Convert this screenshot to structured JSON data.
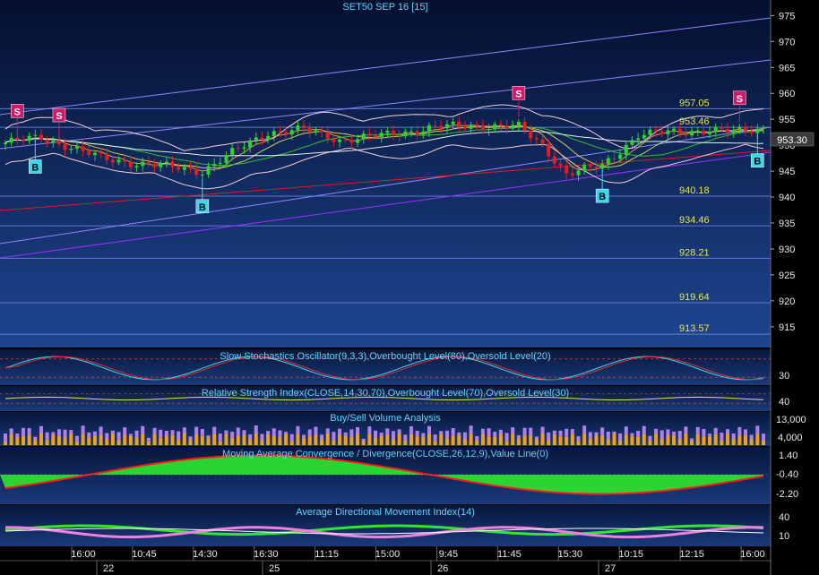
{
  "colors": {
    "panel_top": "#0a1a3c",
    "panel_bottom": "#1b3c80",
    "axis_text": "#e8e8e8",
    "title_text": "#5fd4ff",
    "level_text": "#e6e64a",
    "price_tag": "#3a3a3a",
    "up": "#2fd32f",
    "down": "#e01f1f",
    "buy_marker": "#39d8f0",
    "sell_marker": "#d4186a",
    "stoch_k": "#3fd8f0",
    "stoch_d": "#e03030",
    "rsi": "#e6e64a",
    "vol_up": "#f0a020",
    "vol_down": "#b080f0",
    "macd_pos": "#2ee82e",
    "macd_neg": "#ff1a1a",
    "adx_pos": "#2ee82e",
    "adx_neg": "#f080e0"
  },
  "main": {
    "title": "SET50 SEP 16   [15]",
    "current_price_tag": "953.30",
    "y_labels": [
      "975",
      "970",
      "965",
      "960",
      "955",
      "950",
      "945",
      "940",
      "935",
      "930",
      "925",
      "920",
      "915"
    ],
    "ylim": [
      911,
      978
    ],
    "levels": [
      {
        "label": "957.05",
        "value": 957.05
      },
      {
        "label": "953.46",
        "value": 953.46
      },
      {
        "label": "940.18",
        "value": 940.18
      },
      {
        "label": "934.46",
        "value": 934.46
      },
      {
        "label": "928.21",
        "value": 928.21
      },
      {
        "label": "919.64",
        "value": 919.64
      },
      {
        "label": "913.57",
        "value": 913.57
      }
    ],
    "markers": [
      {
        "type": "S",
        "text": "S",
        "bar": 2
      },
      {
        "type": "S",
        "text": "S",
        "bar": 9
      },
      {
        "type": "B",
        "text": "B",
        "bar": 5
      },
      {
        "type": "B",
        "text": "B",
        "bar": 33
      },
      {
        "type": "S",
        "text": "S",
        "bar": 86
      },
      {
        "type": "B",
        "text": "B",
        "bar": 100
      },
      {
        "type": "S",
        "text": "S",
        "bar": 123
      },
      {
        "type": "B",
        "text": "B",
        "bar": 126
      }
    ]
  },
  "indicators": {
    "stoch": {
      "title": "Slow Stochastics Oscillator(9,3,3),Overbought Level(80),Oversold Level(20)",
      "y_label": "30"
    },
    "rsi": {
      "title": "Relative Strength Index(CLOSE,14,30,70),Overbought Level(70),Oversold Level(30)",
      "y_label": "40"
    },
    "volume": {
      "title": "Buy/Sell Volume Analysis",
      "y_labels": [
        "13,000",
        "4,000"
      ]
    },
    "macd": {
      "title": "Moving Average Convergence / Divergence(CLOSE,26,12,9),Value Line(0)",
      "y_labels": [
        "1.40",
        "-0.40",
        "-2.20"
      ]
    },
    "adx": {
      "title": "Average Directional Movement Index(14)",
      "y_labels": [
        "40",
        "10"
      ]
    }
  },
  "x_axis": {
    "time_labels": [
      "16:00",
      "10:45",
      "14:30",
      "16:30",
      "11:15",
      "15:00",
      "9:45",
      "11:45",
      "15:30",
      "10:15",
      "12:15",
      "16:00"
    ],
    "date_labels": [
      "22",
      "25",
      "26",
      "27"
    ]
  }
}
